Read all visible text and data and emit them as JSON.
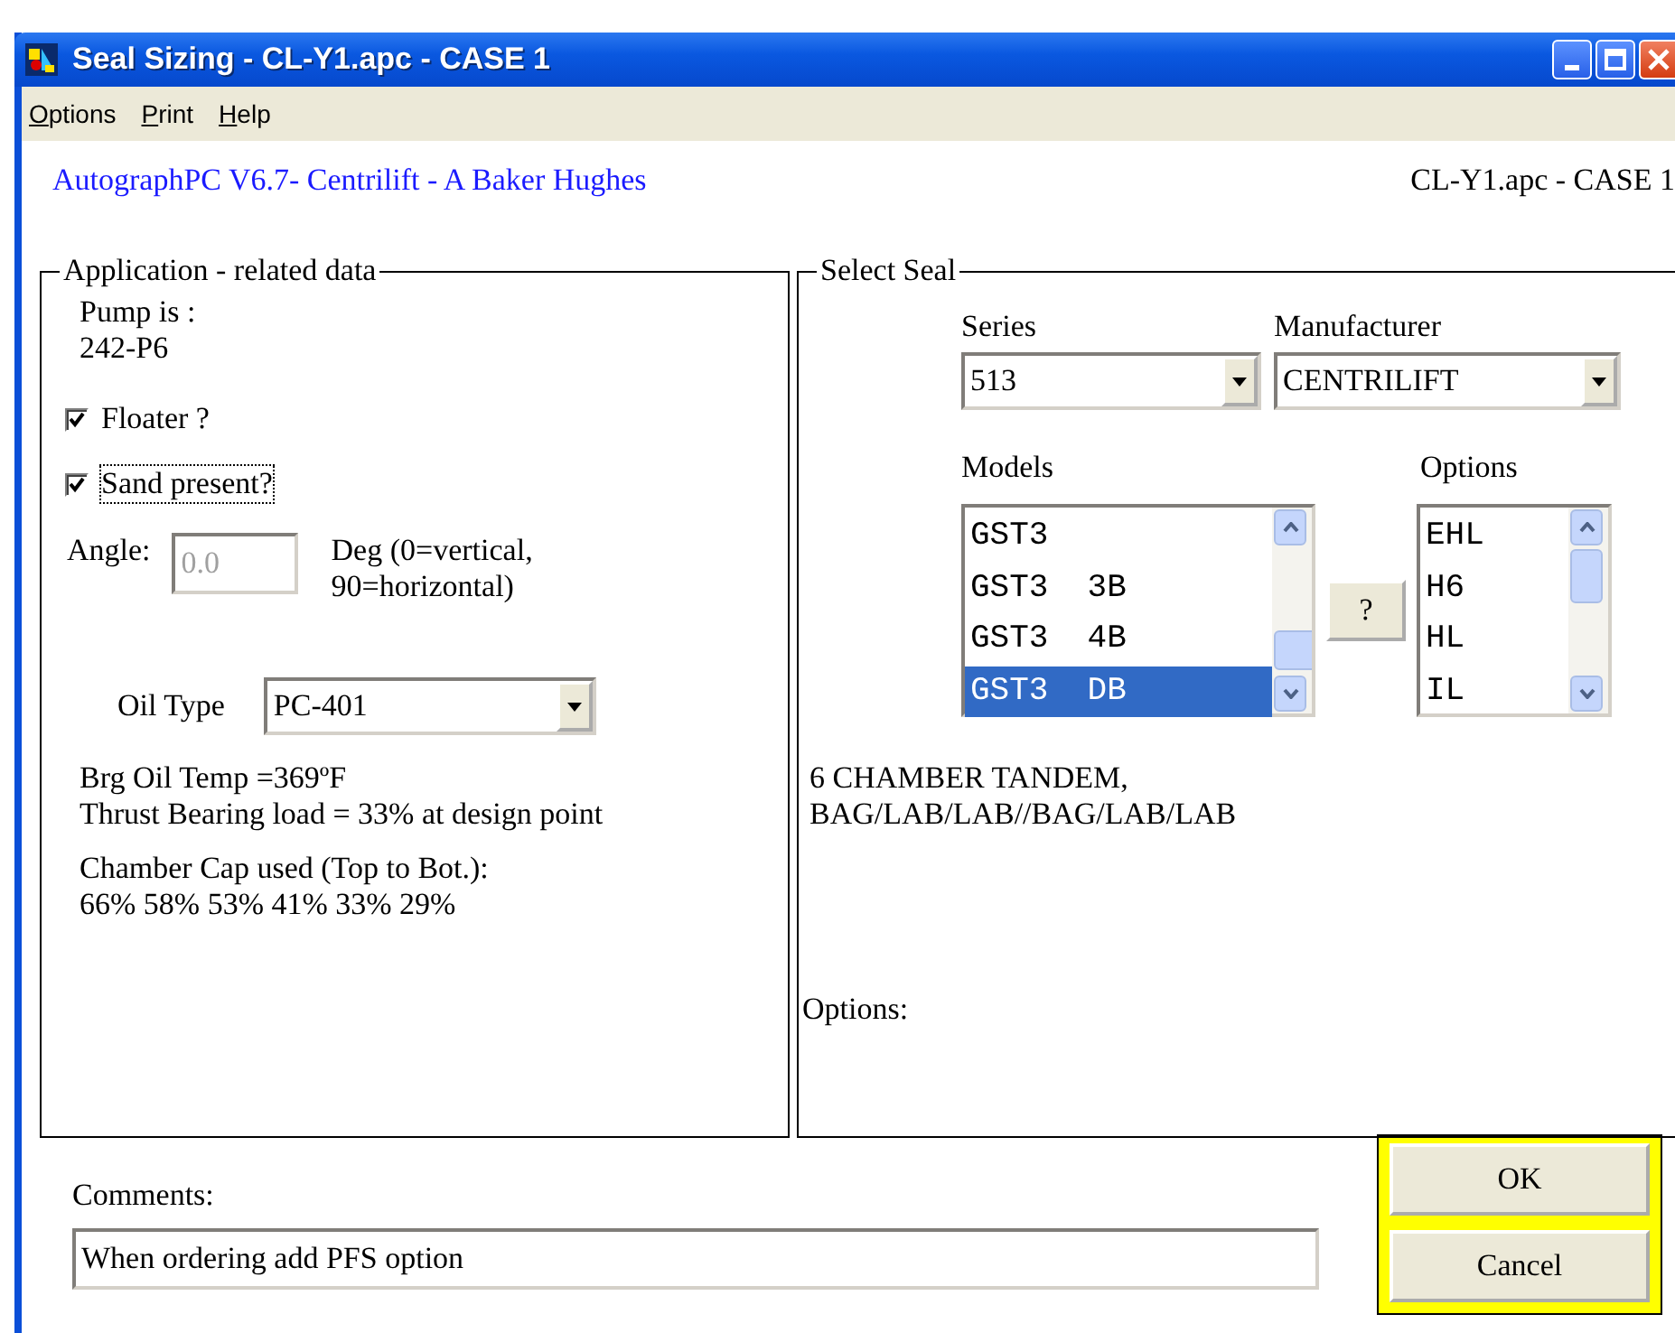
{
  "window": {
    "title": "Seal Sizing - CL-Y1.apc - CASE 1",
    "controls": [
      {
        "kind": "minimize"
      },
      {
        "kind": "maximize"
      },
      {
        "kind": "close"
      }
    ]
  },
  "menu": [
    {
      "label": "Options"
    },
    {
      "label": "Print"
    },
    {
      "label": "Help"
    }
  ],
  "header": {
    "product": "AutographPC V6.7- Centrilift - A Baker Hughes",
    "file": "CL-Y1.apc - CASE 1"
  },
  "application": {
    "legend": "Application - related data",
    "pump_label": "Pump is :",
    "pump_value": "242-P6",
    "checkboxes": [
      {
        "label": "Floater ?",
        "checked": true,
        "focused": false
      },
      {
        "label": "Sand present?",
        "checked": true,
        "focused": true
      }
    ],
    "angle": {
      "label": "Angle:",
      "value": "0.0",
      "disabled": true,
      "unit": "Deg (0=vertical, 90=horizontal)"
    },
    "oil_type": {
      "label": "Oil Type",
      "value": "PC-401"
    },
    "temperature": "Brg Oil Temp =369ºF",
    "thrust": "Thrust Bearing load = 33% at design point",
    "chamber_label": "Chamber Cap used (Top to Bot.):",
    "chamber_values": "66% 58% 53% 41% 33% 29%"
  },
  "seal": {
    "legend": "Select Seal",
    "series": {
      "label": "Series",
      "value": "513"
    },
    "manufacturer": {
      "label": "Manufacturer",
      "value": "CENTRILIFT"
    },
    "models": {
      "label": "Models",
      "items": [
        {
          "text": "GST3",
          "selected": false
        },
        {
          "text": "GST3  3B",
          "selected": false
        },
        {
          "text": "GST3  4B",
          "selected": false
        },
        {
          "text": "GST3  DB",
          "selected": true
        }
      ]
    },
    "help_button": "?",
    "options": {
      "label": "Options",
      "items": [
        {
          "text": "EHL",
          "selected": false
        },
        {
          "text": "H6",
          "selected": false
        },
        {
          "text": "HL",
          "selected": false
        },
        {
          "text": "IL",
          "selected": false
        }
      ]
    },
    "description": "6 CHAMBER TANDEM,\nBAG/LAB/LAB//BAG/LAB/LAB",
    "options_label": "Options:"
  },
  "comments": {
    "label": "Comments:",
    "value": "When ordering add PFS option"
  },
  "buttons": {
    "highlighted": true,
    "items": [
      {
        "label": "OK"
      },
      {
        "label": "Cancel"
      }
    ]
  }
}
